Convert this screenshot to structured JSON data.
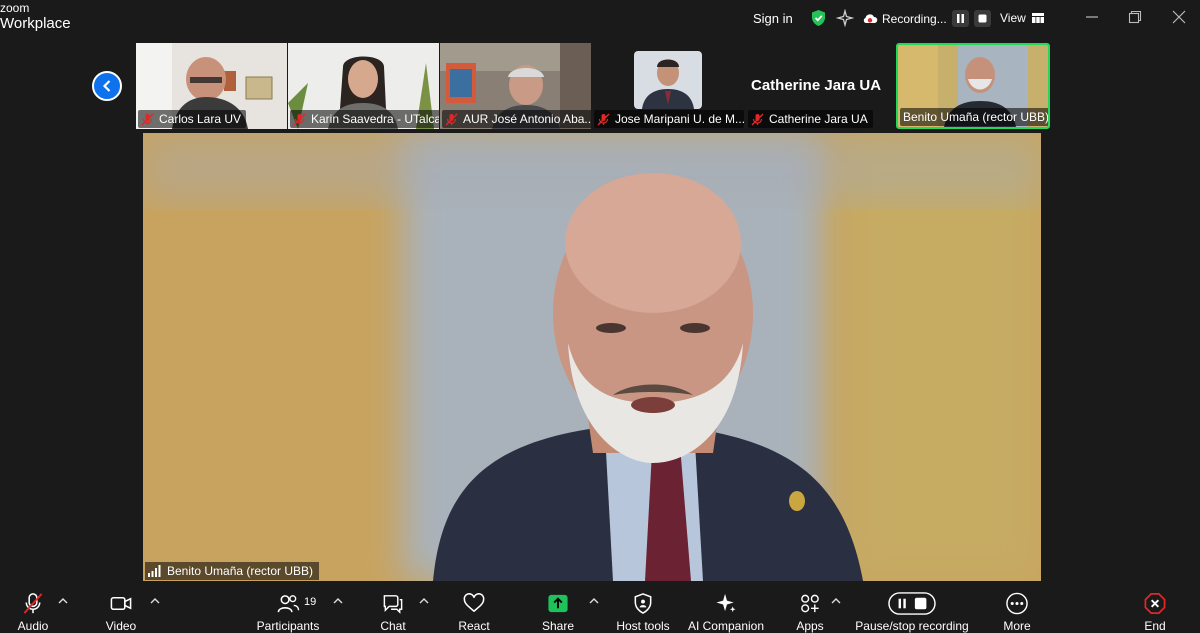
{
  "app": {
    "brand_top": "zoom",
    "brand_bottom": "Workplace"
  },
  "titlebar": {
    "sign_in": "Sign in",
    "recording_label": "Recording...",
    "view_label": "View"
  },
  "thumbnails": [
    {
      "name": "Carlos Lara UV",
      "muted": true
    },
    {
      "name": "Karin Saavedra - UTalca",
      "muted": true
    },
    {
      "name": "AUR José Antonio Aba...",
      "muted": true
    },
    {
      "name": "Jose Maripani U. de M...",
      "muted": true
    },
    {
      "name": "Catherine Jara UA",
      "muted": true,
      "big_name": "Catherine Jara UA"
    },
    {
      "name": "Benito Umaña (rector UBB)",
      "muted": false,
      "active": true
    }
  ],
  "main_video": {
    "speaker_name": "Benito Umaña (rector UBB)"
  },
  "toolbar": {
    "audio": "Audio",
    "video": "Video",
    "participants": "Participants",
    "participants_count": "19",
    "chat": "Chat",
    "react": "React",
    "share": "Share",
    "host_tools": "Host tools",
    "ai_companion": "AI Companion",
    "apps": "Apps",
    "pause_stop_recording": "Pause/stop recording",
    "more": "More",
    "end": "End"
  },
  "colors": {
    "accent_blue": "#0e72ed",
    "active_green": "#23d959",
    "share_green": "#1fc15a",
    "end_red": "#e02828",
    "mute_red": "#e02828"
  }
}
